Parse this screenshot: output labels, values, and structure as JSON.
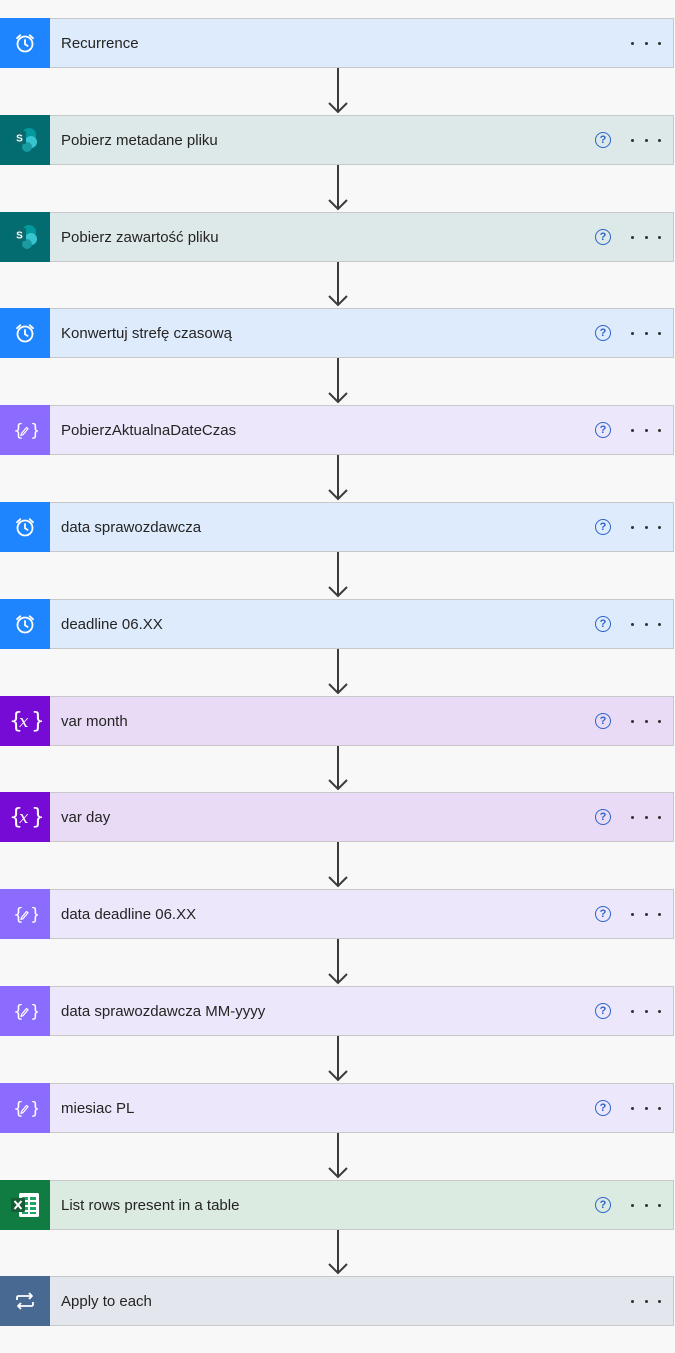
{
  "flow": {
    "steps": [
      {
        "title": "Recurrence",
        "icon": "alarm-clock-icon",
        "kind": "schedule",
        "help": false
      },
      {
        "title": "Pobierz metadane pliku",
        "icon": "sharepoint-icon",
        "kind": "sharepoint",
        "help": true
      },
      {
        "title": "Pobierz zawartość pliku",
        "icon": "sharepoint-icon",
        "kind": "sharepoint",
        "help": true
      },
      {
        "title": "Konwertuj strefę czasową",
        "icon": "alarm-clock-icon",
        "kind": "schedule",
        "help": true
      },
      {
        "title": "PobierzAktualnaDateCzas",
        "icon": "compose-icon",
        "kind": "compose",
        "help": true
      },
      {
        "title": "data sprawozdawcza",
        "icon": "alarm-clock-icon",
        "kind": "schedule",
        "help": true
      },
      {
        "title": "deadline 06.XX",
        "icon": "alarm-clock-icon",
        "kind": "schedule",
        "help": true
      },
      {
        "title": "var month",
        "icon": "variable-icon",
        "kind": "variable",
        "help": true
      },
      {
        "title": "var day",
        "icon": "variable-icon",
        "kind": "variable",
        "help": true
      },
      {
        "title": "data deadline 06.XX",
        "icon": "compose-icon",
        "kind": "compose",
        "help": true
      },
      {
        "title": "data sprawozdawcza MM-yyyy",
        "icon": "compose-icon",
        "kind": "compose",
        "help": true
      },
      {
        "title": "miesiac PL",
        "icon": "compose-icon",
        "kind": "compose",
        "help": true
      },
      {
        "title": "List rows present in a table",
        "icon": "excel-icon",
        "kind": "excel",
        "help": true
      },
      {
        "title": "Apply to each",
        "icon": "loop-icon",
        "kind": "control",
        "help": false
      }
    ]
  },
  "help_glyph": "?",
  "colors": {
    "schedule": {
      "icon_bg": "#1f85ff",
      "card_bg": "#ddebfc"
    },
    "sharepoint": {
      "icon_bg": "#036c70",
      "card_bg": "#dde8e8"
    },
    "compose": {
      "icon_bg": "#8c6cff",
      "card_bg": "#ede7fc"
    },
    "variable": {
      "icon_bg": "#770bd6",
      "card_bg": "#e9dbf6"
    },
    "excel": {
      "icon_bg": "#107c41",
      "card_bg": "#dbebe2"
    },
    "control": {
      "icon_bg": "#486991",
      "card_bg": "#e3e7ed"
    },
    "help": "#2b63c9",
    "connector": "#3b3b3b"
  }
}
